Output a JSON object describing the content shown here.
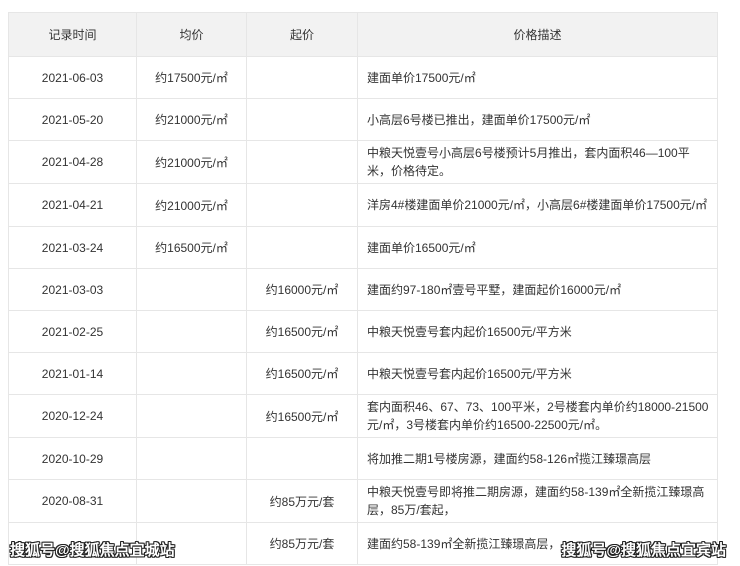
{
  "table": {
    "headers": {
      "date": "记录时间",
      "avg": "均价",
      "start": "起价",
      "desc": "价格描述"
    },
    "rows": [
      {
        "date": "2021-06-03",
        "avg": "约17500元/㎡",
        "start": "",
        "desc": "建面单价17500元/㎡"
      },
      {
        "date": "2021-05-20",
        "avg": "约21000元/㎡",
        "start": "",
        "desc": "小高层6号楼已推出，建面单价17500元/㎡"
      },
      {
        "date": "2021-04-28",
        "avg": "约21000元/㎡",
        "start": "",
        "desc": "中粮天悦壹号小高层6号楼预计5月推出，套内面积46—100平米，价格待定。"
      },
      {
        "date": "2021-04-21",
        "avg": "约21000元/㎡",
        "start": "",
        "desc": "洋房4#楼建面单价21000元/㎡，小高层6#楼建面单价17500元/㎡"
      },
      {
        "date": "2021-03-24",
        "avg": "约16500元/㎡",
        "start": "",
        "desc": "建面单价16500元/㎡"
      },
      {
        "date": "2021-03-03",
        "avg": "",
        "start": "约16000元/㎡",
        "desc": "建面约97-180㎡壹号平墅，建面起价16000元/㎡"
      },
      {
        "date": "2021-02-25",
        "avg": "",
        "start": "约16500元/㎡",
        "desc": "中粮天悦壹号套内起价16500元/平方米"
      },
      {
        "date": "2021-01-14",
        "avg": "",
        "start": "约16500元/㎡",
        "desc": "中粮天悦壹号套内起价16500元/平方米"
      },
      {
        "date": "2020-12-24",
        "avg": "",
        "start": "约16500元/㎡",
        "desc": "套内面积46、67、73、100平米，2号楼套内单价约18000-21500元/㎡，3号楼套内单价约16500-22500元/㎡。"
      },
      {
        "date": "2020-10-29",
        "avg": "",
        "start": "",
        "desc": "将加推二期1号楼房源，建面约58-126㎡揽江臻璟高层"
      },
      {
        "date": "2020-08-31",
        "avg": "",
        "start": "约85万元/套",
        "desc": "中粮天悦壹号即将推二期房源，建面约58-139㎡全新揽江臻璟高层，85万/套起，"
      },
      {
        "date": "",
        "avg": "",
        "start": "约85万元/套",
        "desc": "建面约58-139㎡全新揽江臻璟高层，"
      }
    ]
  },
  "watermarks": {
    "left": "搜狐号@搜狐焦点宜城站",
    "right": "搜狐号@搜狐焦点宜宾站"
  }
}
